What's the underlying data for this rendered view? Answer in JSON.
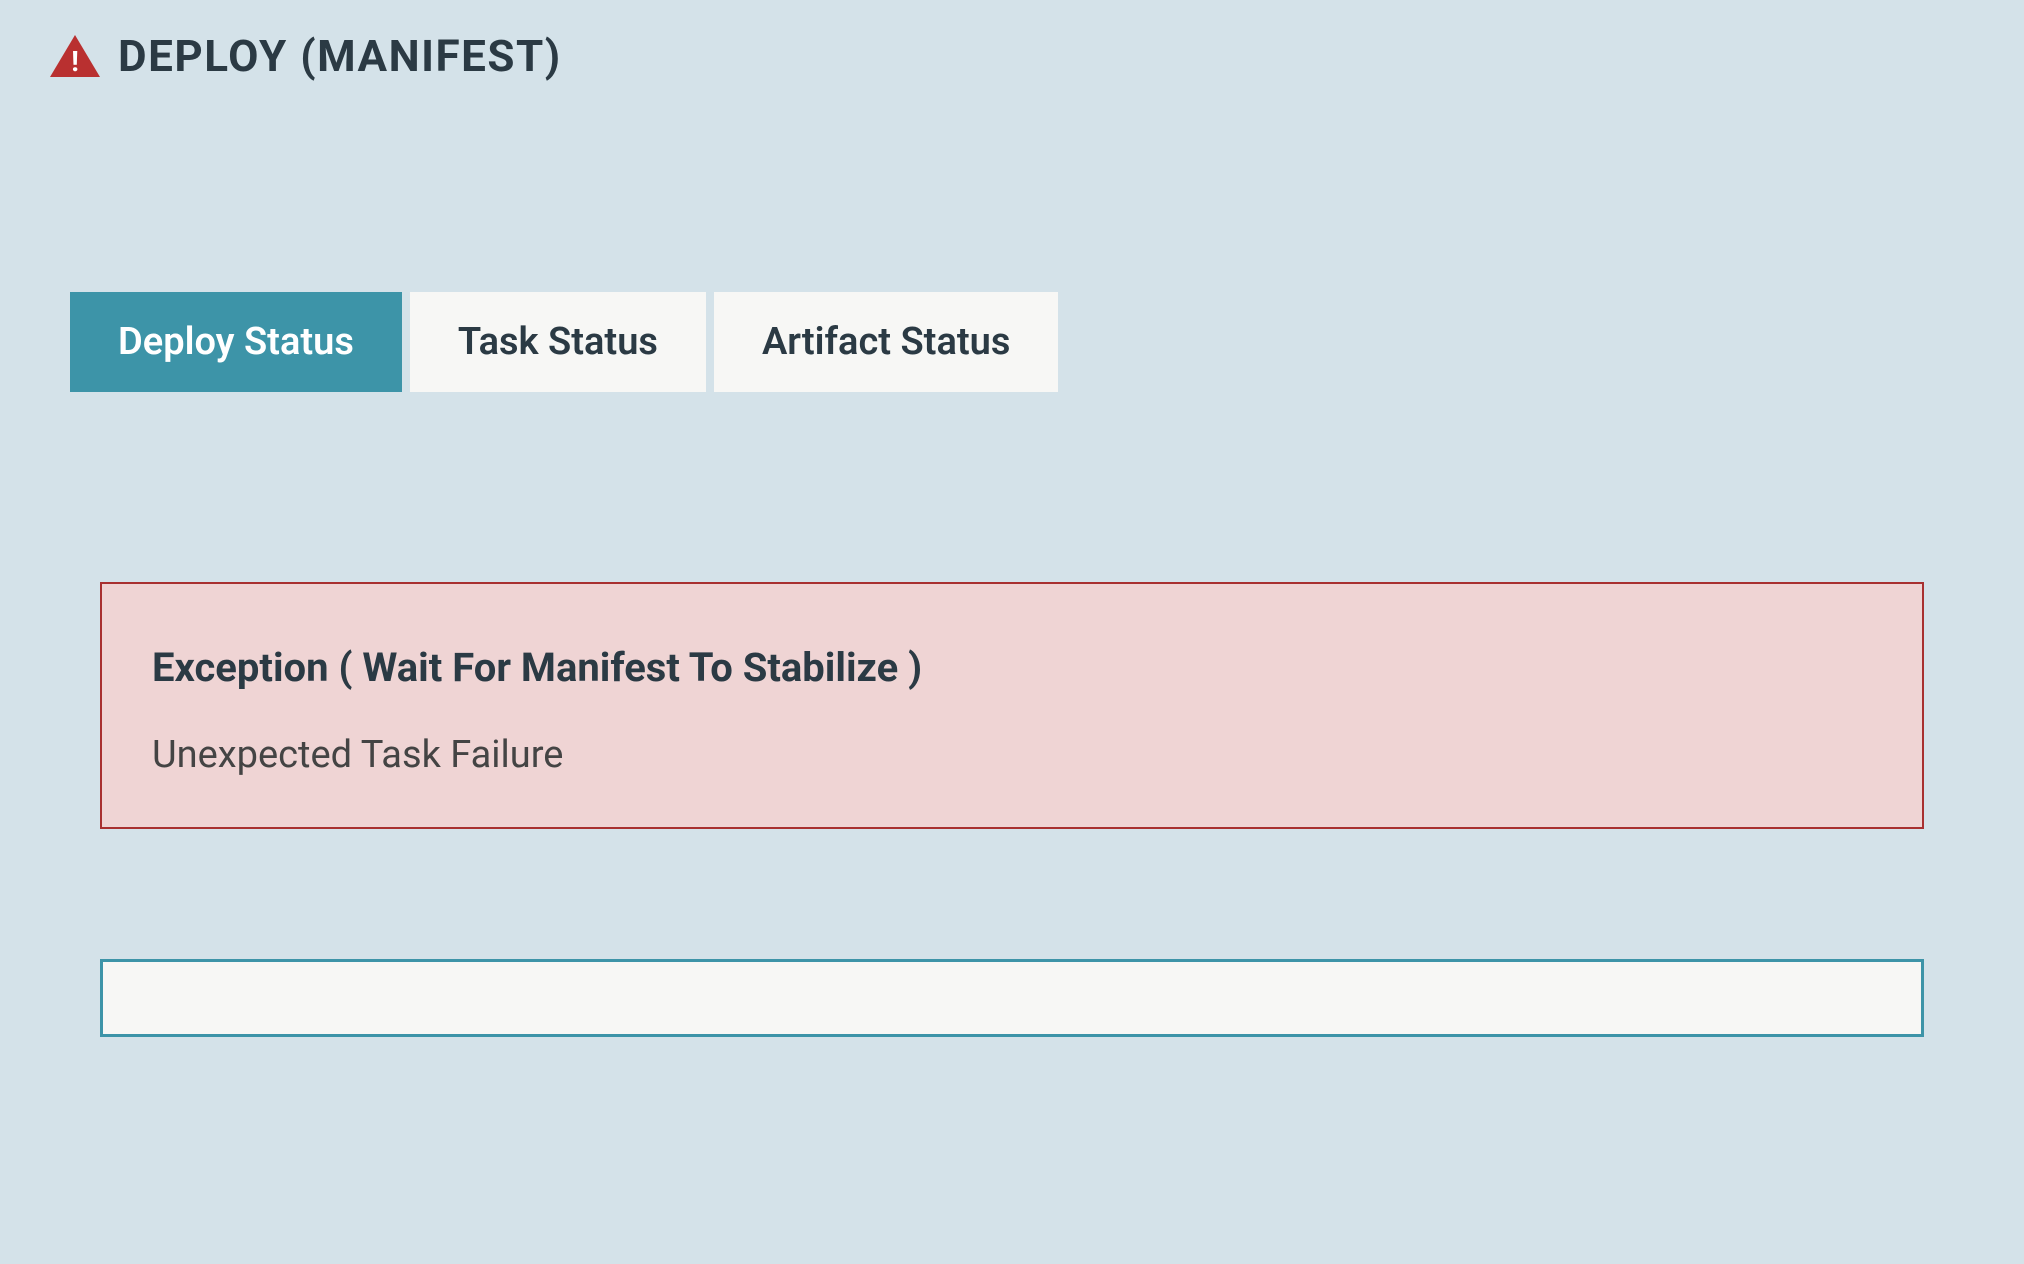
{
  "header": {
    "title": "DEPLOY (MANIFEST)",
    "icon": "warning-triangle-icon"
  },
  "tabs": [
    {
      "label": "Deploy Status",
      "active": true
    },
    {
      "label": "Task Status",
      "active": false
    },
    {
      "label": "Artifact Status",
      "active": false
    }
  ],
  "error": {
    "title": "Exception ( Wait For Manifest To Stabilize )",
    "message": "Unexpected Task Failure"
  },
  "colors": {
    "background": "#d4e2e9",
    "tabActive": "#3d94a8",
    "tabInactive": "#f7f7f5",
    "errorBorder": "#a83030",
    "errorBackground": "#efd4d4",
    "warningIcon": "#b93030",
    "inputBorder": "#3d94a8"
  }
}
